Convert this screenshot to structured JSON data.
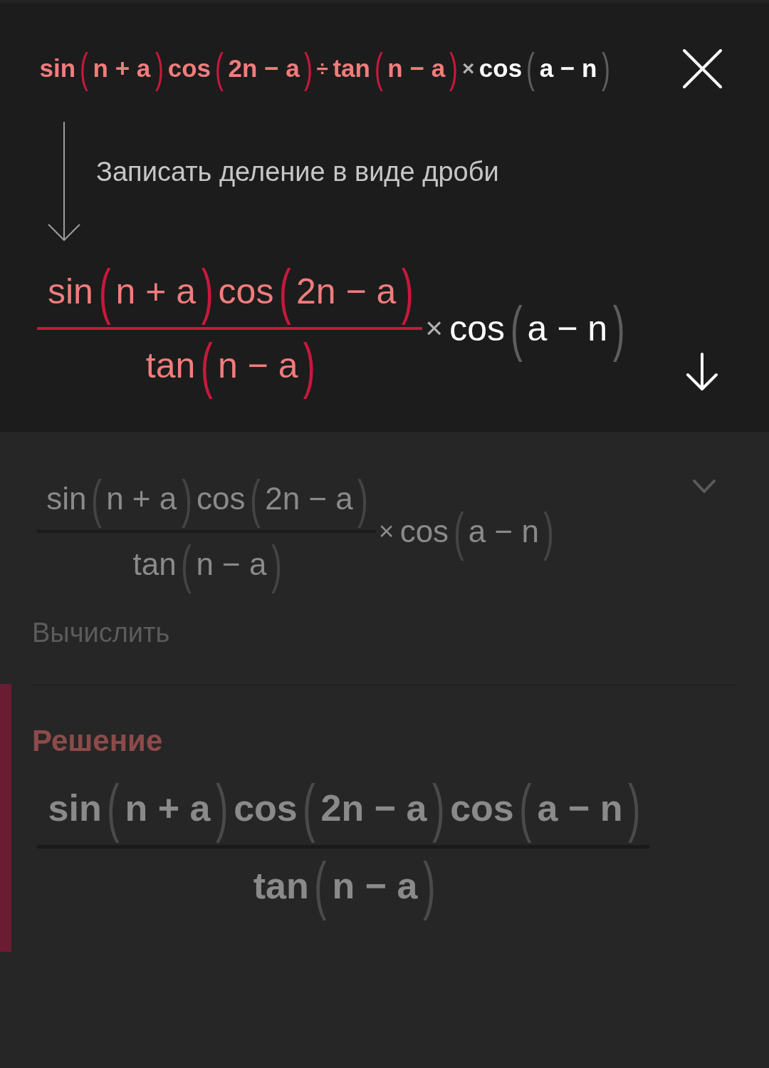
{
  "step": {
    "expression": [
      {
        "kind": "run",
        "highlighted": true,
        "tokens": [
          {
            "kind": "text",
            "text": "sin"
          },
          {
            "kind": "paren",
            "text": "("
          },
          {
            "kind": "text",
            "text": "n + a"
          },
          {
            "kind": "paren",
            "text": ")"
          },
          {
            "kind": "text",
            "text": "cos"
          },
          {
            "kind": "paren",
            "text": "("
          },
          {
            "kind": "text",
            "text": "2n − a"
          },
          {
            "kind": "paren",
            "text": ")"
          },
          {
            "kind": "op",
            "text": "÷"
          },
          {
            "kind": "text",
            "text": "tan"
          },
          {
            "kind": "paren",
            "text": "("
          },
          {
            "kind": "text",
            "text": "n − a"
          },
          {
            "kind": "paren",
            "text": ")"
          }
        ]
      },
      {
        "kind": "run",
        "highlighted": false,
        "tokens": [
          {
            "kind": "op",
            "text": "×"
          },
          {
            "kind": "text",
            "text": "cos"
          },
          {
            "kind": "paren",
            "text": "("
          },
          {
            "kind": "text",
            "text": "a − n"
          },
          {
            "kind": "paren",
            "text": ")"
          }
        ]
      }
    ],
    "description": "Записать деление в виде дроби",
    "result": [
      {
        "kind": "fraction",
        "highlighted": true,
        "numerator": [
          {
            "kind": "text",
            "text": "sin"
          },
          {
            "kind": "paren",
            "text": "("
          },
          {
            "kind": "text",
            "text": "n + a"
          },
          {
            "kind": "paren",
            "text": ")"
          },
          {
            "kind": "text",
            "text": "cos"
          },
          {
            "kind": "paren",
            "text": "("
          },
          {
            "kind": "text",
            "text": "2n − a"
          },
          {
            "kind": "paren",
            "text": ")"
          }
        ],
        "denominator": [
          {
            "kind": "text",
            "text": "tan"
          },
          {
            "kind": "paren",
            "text": "("
          },
          {
            "kind": "text",
            "text": "n − a"
          },
          {
            "kind": "paren",
            "text": ")"
          }
        ]
      },
      {
        "kind": "run",
        "highlighted": false,
        "tokens": [
          {
            "kind": "op",
            "text": "×"
          },
          {
            "kind": "text",
            "text": "cos"
          },
          {
            "kind": "paren",
            "text": "("
          },
          {
            "kind": "text",
            "text": "a − n"
          },
          {
            "kind": "paren",
            "text": ")"
          }
        ]
      }
    ]
  },
  "next_step": {
    "dimmed": true,
    "expression": [
      {
        "kind": "fraction",
        "numerator": [
          {
            "kind": "text",
            "text": "sin"
          },
          {
            "kind": "paren",
            "text": "("
          },
          {
            "kind": "text",
            "text": "n + a"
          },
          {
            "kind": "paren",
            "text": ")"
          },
          {
            "kind": "text",
            "text": "cos"
          },
          {
            "kind": "paren",
            "text": "("
          },
          {
            "kind": "text",
            "text": "2n − a"
          },
          {
            "kind": "paren",
            "text": ")"
          }
        ],
        "denominator": [
          {
            "kind": "text",
            "text": "tan"
          },
          {
            "kind": "paren",
            "text": "("
          },
          {
            "kind": "text",
            "text": "n − a"
          },
          {
            "kind": "paren",
            "text": ")"
          }
        ]
      },
      {
        "kind": "run",
        "tokens": [
          {
            "kind": "op",
            "text": "×"
          },
          {
            "kind": "text",
            "text": "cos"
          },
          {
            "kind": "paren",
            "text": "("
          },
          {
            "kind": "text",
            "text": "a − n"
          },
          {
            "kind": "paren",
            "text": ")"
          }
        ]
      }
    ],
    "label": "Вычислить"
  },
  "solution": {
    "dimmed": true,
    "title": "Решение",
    "expression": [
      {
        "kind": "fraction",
        "numerator": [
          {
            "kind": "text",
            "text": "sin"
          },
          {
            "kind": "paren",
            "text": "("
          },
          {
            "kind": "text",
            "text": "n + a"
          },
          {
            "kind": "paren",
            "text": ")"
          },
          {
            "kind": "text",
            "text": "cos"
          },
          {
            "kind": "paren",
            "text": "("
          },
          {
            "kind": "text",
            "text": "2n − a"
          },
          {
            "kind": "paren",
            "text": ")"
          },
          {
            "kind": "text",
            "text": "cos"
          },
          {
            "kind": "paren",
            "text": "("
          },
          {
            "kind": "text",
            "text": "a − n"
          },
          {
            "kind": "paren",
            "text": ")"
          }
        ],
        "denominator": [
          {
            "kind": "text",
            "text": "tan"
          },
          {
            "kind": "paren",
            "text": "("
          },
          {
            "kind": "text",
            "text": "n − a"
          },
          {
            "kind": "paren",
            "text": ")"
          }
        ]
      }
    ]
  }
}
